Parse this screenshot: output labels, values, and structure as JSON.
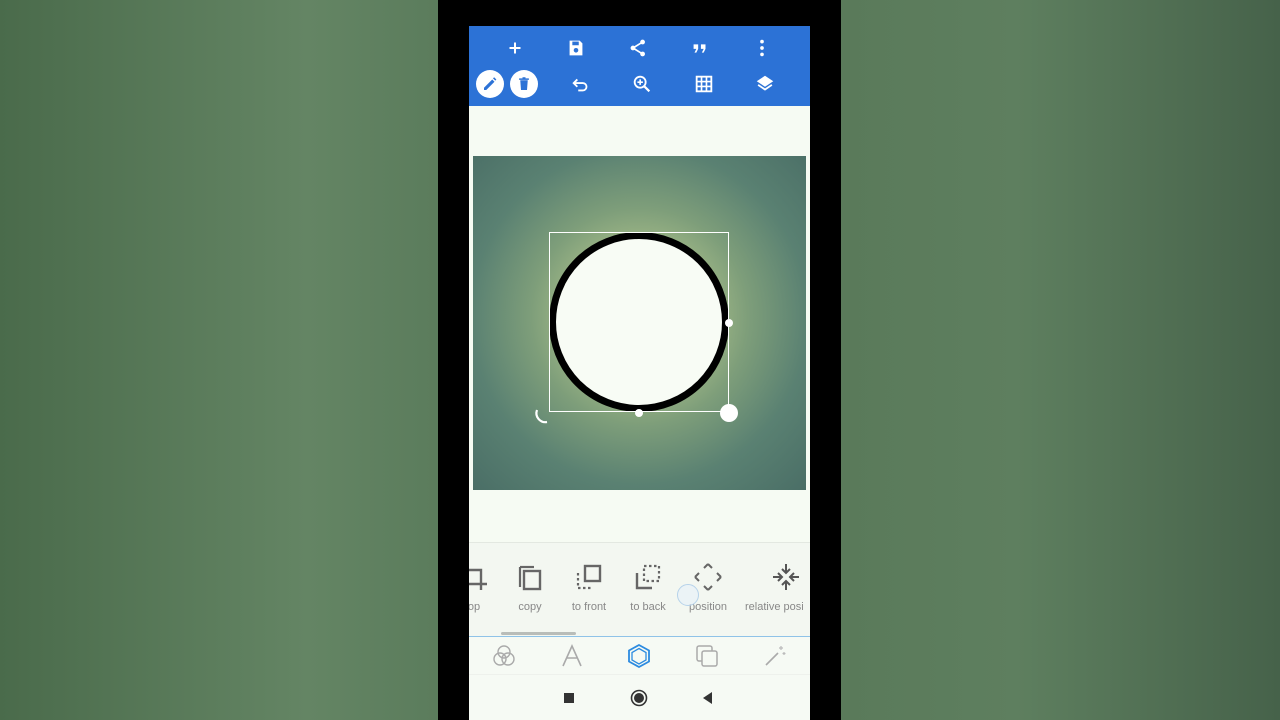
{
  "toolbar": {
    "row1": [
      "add-icon",
      "save-icon",
      "share-icon",
      "quote-icon",
      "more-vert-icon"
    ],
    "row2": [
      "pencil-icon",
      "trash-icon",
      "undo-icon",
      "zoom-in-icon",
      "grid-icon",
      "layers-icon"
    ],
    "color": "#2c72d6"
  },
  "actions": [
    {
      "label": "op",
      "icon": "crop-icon"
    },
    {
      "label": "copy",
      "icon": "copy-icon"
    },
    {
      "label": "to front",
      "icon": "to-front-icon"
    },
    {
      "label": "to back",
      "icon": "to-back-icon"
    },
    {
      "label": "position",
      "icon": "position-icon"
    },
    {
      "label": "relative posi",
      "icon": "relative-position-icon"
    }
  ],
  "tabs": [
    {
      "icon": "color-blend-icon",
      "active": false
    },
    {
      "icon": "text-icon",
      "active": false
    },
    {
      "icon": "shape-hexagon-icon",
      "active": true
    },
    {
      "icon": "duplicate-icon",
      "active": false
    },
    {
      "icon": "magic-wand-icon",
      "active": false
    }
  ],
  "nav": [
    "recents-icon",
    "home-icon",
    "back-icon"
  ],
  "colors": {
    "accent": "#2c72d6",
    "active_tab": "#2c8be0",
    "shape_stroke": "#000000",
    "shape_fill": "#f8fcf5"
  }
}
